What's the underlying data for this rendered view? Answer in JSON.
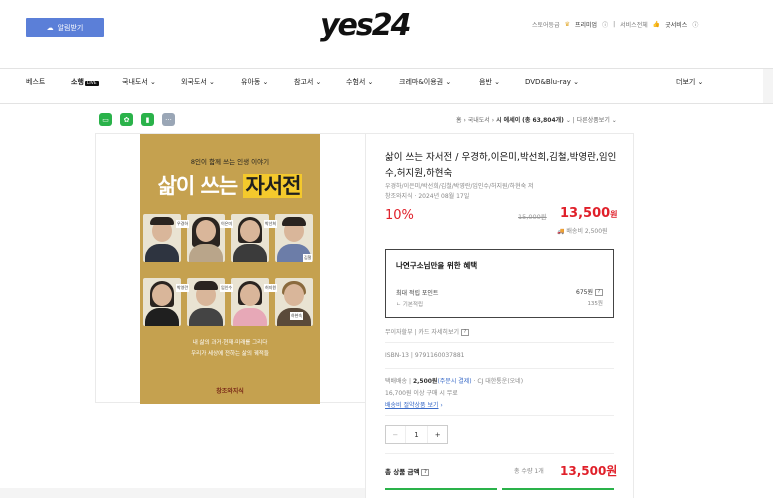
{
  "header": {
    "alarm_label": "알림받기",
    "logo": "yes24",
    "toplinks": {
      "store": "스토어등급",
      "premium": "프리미엄",
      "service": "서비스전체",
      "youbiz": "굿서비스"
    }
  },
  "nav": {
    "items": [
      "베스트",
      "소행",
      "국내도서",
      "외국도서",
      "유아동",
      "참고서",
      "수험서",
      "크레마&이용권",
      "음반",
      "DVD&Blu-ray",
      "더보기"
    ],
    "live_badge": "LIVE"
  },
  "breadcrumb": {
    "home": "홈",
    "cat1": "국내도서",
    "cat2": "시 에세이",
    "cat2_count": "(총 63,804개)",
    "other": "다른상품보기"
  },
  "cover": {
    "subtitle": "8인이 함께 쓰는 인생 이야기",
    "title_a": "삶이 쓰는 ",
    "title_b": "자서전",
    "names": [
      "우경하",
      "이은미",
      "박선희",
      "김철",
      "박영란",
      "임인수",
      "허지원",
      "하현숙"
    ],
    "line1": "내 삶의 과거·현재·미래를 그리다",
    "line2": "우리가 세상에 전하는 삶의 궤적들",
    "publisher": "창조와지식"
  },
  "product": {
    "title": "삶이 쓰는 자서전 / 우경하,이은미,박선희,김철,박영란,임인수,허지원,하현숙",
    "authors": "우경하/이은미/박선희/김철/박영란/임인수/허지원/하현숙 저",
    "publisher_date": "창조와지식 · 2024년 08월 17일",
    "discount": "10%",
    "original_price": "15,000원",
    "price": "13,500",
    "price_unit": "원",
    "shipping": "배송비 2,500원"
  },
  "benefit": {
    "title": "나연구소님만을 위한 혜택",
    "point_label": "최대 적립 포인트",
    "point_value": "675원",
    "base_label": "ㄴ 기본적립",
    "base_value": "135원"
  },
  "free_interest": "무이자할부 | 카드 자세히보기",
  "isbn": {
    "label": "ISBN-13",
    "value": "9791160037881"
  },
  "delivery": {
    "label": "택배배송",
    "fee": "2,500원",
    "condition": "(주문시 결제)",
    "carrier": "· CJ 대한통운(오네)",
    "free_cond": "16,700원 이상 구매 시 무료",
    "policy_link": "배송비 절약상품 보기"
  },
  "quantity": {
    "minus": "−",
    "value": "1",
    "plus": "+"
  },
  "total": {
    "label": "총 상품 금액",
    "count": "총 수량 1개",
    "value": "13,500원"
  }
}
